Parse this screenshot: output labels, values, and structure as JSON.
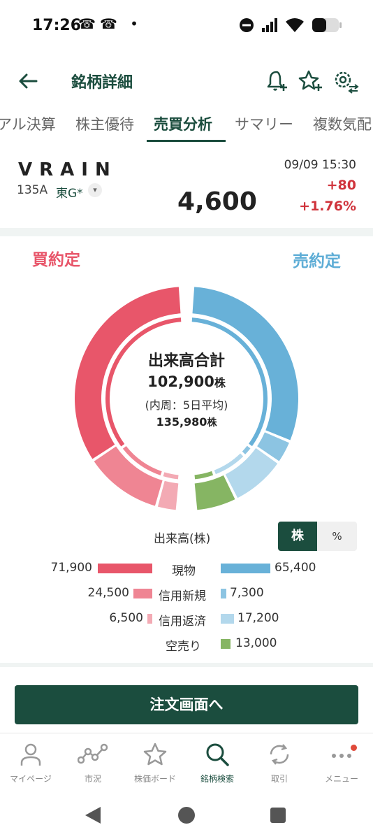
{
  "status_bar": {
    "time": "17:26",
    "left_icons": "☎☎ •"
  },
  "header": {
    "title": "銘柄詳細"
  },
  "tabs": [
    {
      "label": "アル決算"
    },
    {
      "label": "株主優待"
    },
    {
      "label": "売買分析"
    },
    {
      "label": "サマリー"
    },
    {
      "label": "複数気配"
    }
  ],
  "stock": {
    "name": "VRAIN",
    "code": "135A",
    "market": "東G*",
    "datetime": "09/09 15:30",
    "change": "+80",
    "change_pct": "+1.76%",
    "price": "4,600"
  },
  "analysis": {
    "buy_label": "買約定",
    "sell_label": "売約定",
    "center_title": "出来高合計",
    "total_volume": "102,900",
    "unit": "株",
    "inner_caption": "(内周：5日平均)",
    "avg_volume": "135,980",
    "volume_label": "出来高(株)",
    "toggle_shares": "株",
    "toggle_percent": "%",
    "rows": [
      {
        "left": "71,900",
        "category": "現物",
        "right": "65,400"
      },
      {
        "left": "24,500",
        "category": "信用新規",
        "right": "7,300"
      },
      {
        "left": "6,500",
        "category": "信用返済",
        "right": "17,200"
      },
      {
        "left": "",
        "category": "空売り",
        "right": "13,000"
      }
    ],
    "colors": {
      "buy_cash": "#e8566a",
      "buy_margin_new": "#ef8593",
      "buy_margin_close": "#f3aab4",
      "sell_cash": "#68b1d8",
      "sell_margin_new": "#8cc4e2",
      "sell_margin_close": "#b3d8ec",
      "short_sell": "#86b563"
    }
  },
  "chart_data": {
    "type": "pie",
    "title": "出来高合計",
    "outer_ring": {
      "buy": [
        {
          "name": "現物",
          "value": 71900
        },
        {
          "name": "信用新規",
          "value": 24500
        },
        {
          "name": "信用返済",
          "value": 6500
        }
      ],
      "sell": [
        {
          "name": "現物",
          "value": 65400
        },
        {
          "name": "信用新規",
          "value": 7300
        },
        {
          "name": "信用返済",
          "value": 17200
        },
        {
          "name": "空売り",
          "value": 13000
        }
      ]
    },
    "inner_ring_5day_avg_total": 135980
  },
  "order_button": {
    "label": "注文画面へ"
  },
  "bottom_nav": [
    {
      "label": "マイページ",
      "icon": "person-icon"
    },
    {
      "label": "市況",
      "icon": "market-icon"
    },
    {
      "label": "株価ボード",
      "icon": "star-icon"
    },
    {
      "label": "銘柄検索",
      "icon": "search-icon"
    },
    {
      "label": "取引",
      "icon": "refresh-icon"
    },
    {
      "label": "メニュー",
      "icon": "more-icon"
    }
  ]
}
